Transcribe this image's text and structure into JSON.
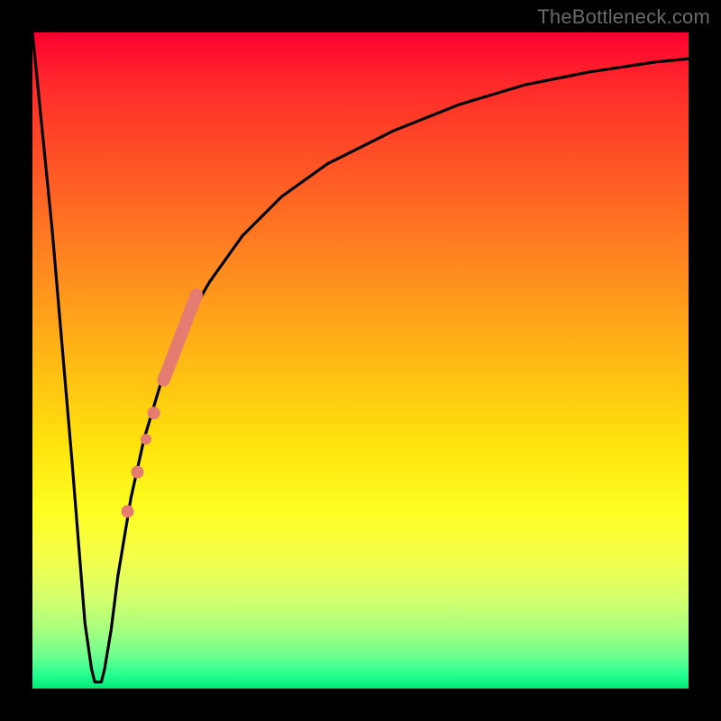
{
  "watermark": {
    "text": "TheBottleneck.com"
  },
  "colors": {
    "frame": "#000000",
    "curve_stroke": "#000000",
    "marker_fill": "#e47c71",
    "marker_stroke": "#cf5d50"
  },
  "chart_data": {
    "type": "line",
    "title": "",
    "xlabel": "",
    "ylabel": "",
    "xlim": [
      0,
      100
    ],
    "ylim": [
      0,
      100
    ],
    "grid": false,
    "legend": false,
    "series": [
      {
        "name": "bottleneck-curve",
        "x": [
          0,
          3,
          6,
          8,
          9,
          9.5,
          10,
          10.5,
          11,
          12,
          13,
          15,
          17,
          20,
          23,
          27,
          32,
          38,
          45,
          55,
          65,
          75,
          85,
          95,
          100
        ],
        "y": [
          100,
          70,
          35,
          10,
          3,
          1,
          1,
          1,
          3,
          9,
          17,
          29,
          38,
          48,
          55,
          62,
          69,
          75,
          80,
          85,
          89,
          92,
          94,
          95.5,
          96
        ]
      }
    ],
    "markers": [
      {
        "kind": "segment",
        "x1": 20,
        "y1": 47,
        "x2": 25,
        "y2": 60,
        "width": 14
      },
      {
        "kind": "dot",
        "x": 18.5,
        "y": 42,
        "r": 7
      },
      {
        "kind": "dot",
        "x": 17.3,
        "y": 38,
        "r": 6
      },
      {
        "kind": "dot",
        "x": 16.0,
        "y": 33,
        "r": 7
      },
      {
        "kind": "dot",
        "x": 14.5,
        "y": 27,
        "r": 7
      }
    ]
  }
}
